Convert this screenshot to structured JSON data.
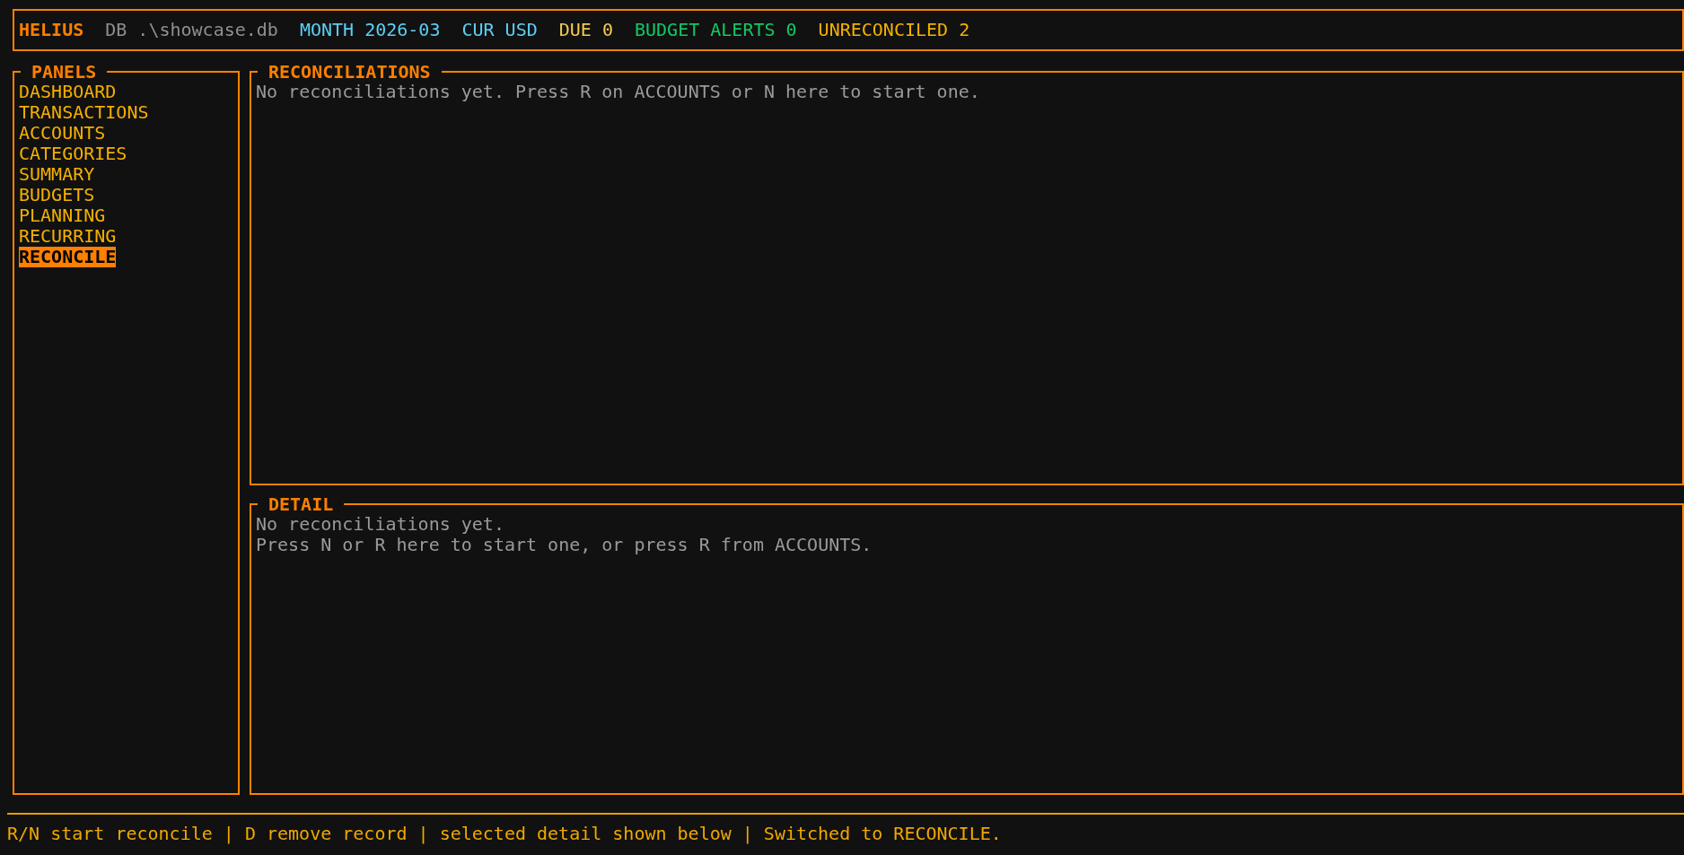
{
  "header": {
    "items": [
      {
        "kind": "brand",
        "text": "HELIUS",
        "color": "#ff7f00"
      },
      {
        "kind": "stat",
        "text": "DB .\\showcase.db",
        "color": "#8f8f8f"
      },
      {
        "kind": "stat",
        "text": "MONTH 2026-03",
        "color": "#5ccff5"
      },
      {
        "kind": "stat",
        "text": "CUR USD",
        "color": "#5ccff5"
      },
      {
        "kind": "stat",
        "text": "DUE 0",
        "color": "#f2cc4e"
      },
      {
        "kind": "stat",
        "text": "BUDGET ALERTS 0",
        "color": "#12c864"
      },
      {
        "kind": "stat",
        "text": "UNRECONCILED 2",
        "color": "#f5b000"
      }
    ]
  },
  "sidebar": {
    "title": "PANELS",
    "items": [
      {
        "label": "DASHBOARD",
        "selected": false
      },
      {
        "label": "TRANSACTIONS",
        "selected": false
      },
      {
        "label": "ACCOUNTS",
        "selected": false
      },
      {
        "label": "CATEGORIES",
        "selected": false
      },
      {
        "label": "SUMMARY",
        "selected": false
      },
      {
        "label": "BUDGETS",
        "selected": false
      },
      {
        "label": "PLANNING",
        "selected": false
      },
      {
        "label": "RECURRING",
        "selected": false
      },
      {
        "label": "RECONCILE",
        "selected": true
      }
    ]
  },
  "reconciliations": {
    "title": "RECONCILIATIONS",
    "message": "No reconciliations yet. Press R on ACCOUNTS or N here to start one."
  },
  "detail": {
    "title": "DETAIL",
    "lines": [
      "No reconciliations yet.",
      "Press N or R here to start one, or press R from ACCOUNTS."
    ]
  },
  "status_bar": {
    "text": "R/N start reconcile | D remove record | selected detail shown below | Switched to RECONCILE."
  }
}
